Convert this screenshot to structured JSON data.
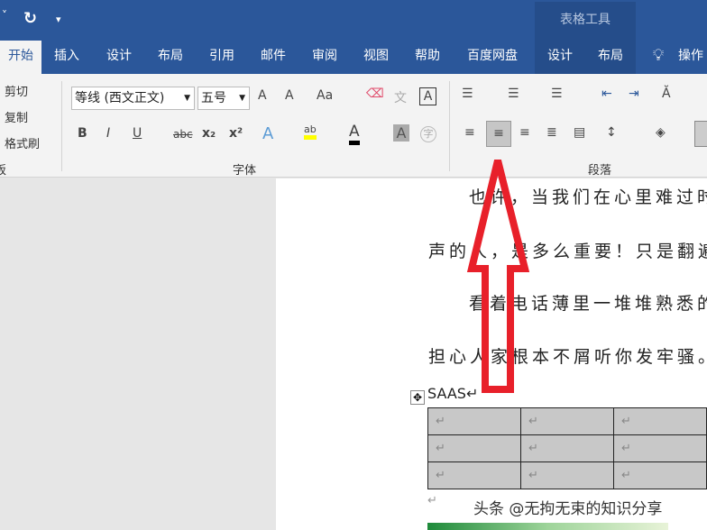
{
  "quick_access": {
    "dropdown": "˅",
    "undo": "↻",
    "customize": "▾"
  },
  "context_tab_group": "表格工具",
  "tabs": [
    "开始",
    "插入",
    "设计",
    "布局",
    "引用",
    "邮件",
    "审阅",
    "视图",
    "帮助",
    "百度网盘",
    "设计",
    "布局",
    "操作"
  ],
  "clipboard": {
    "cut": "剪切",
    "copy": "复制",
    "format_painter": "格式刷",
    "label": "板"
  },
  "font": {
    "name": "等线 (西文正文)",
    "size": "五号",
    "label": "字体",
    "grow": "A",
    "shrink": "A",
    "case": "Aa",
    "bold": "B",
    "italic": "I",
    "underline": "U",
    "strike": "abc",
    "sub": "x₂",
    "sup": "x²",
    "effects": "A",
    "highlight": "ab",
    "color": "A",
    "shade": "A",
    "enclose": "字",
    "phonetic": "文",
    "border": "A"
  },
  "paragraph": {
    "label": "段落"
  },
  "document": {
    "lines": [
      "也许，当我们在心里难过时",
      "声的人，是多么重要！只是翻遍",
      "看着电话薄里一堆堆熟悉的",
      "担心人家根本不屑听你发牢骚。"
    ],
    "heading": "SAAS↵",
    "table": [
      [
        "↵",
        "↵",
        "↵"
      ],
      [
        "↵",
        "↵",
        "↵"
      ],
      [
        "↵",
        "↵",
        "↵"
      ]
    ],
    "after_table": "↵",
    "watermark": "头条 @无拘无束的知识分享"
  },
  "colors": {
    "title_blue": "#2b579a",
    "arrow_red": "#e8202a"
  }
}
